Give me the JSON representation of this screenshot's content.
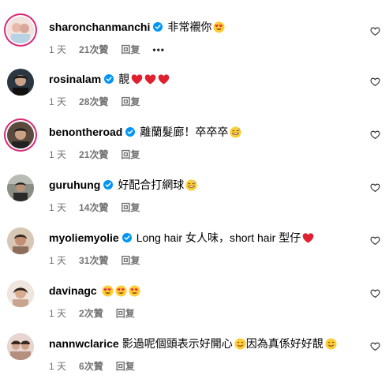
{
  "comments": [
    {
      "username": "sharonchanmanchi",
      "text": "非常襯你",
      "emojis": [
        "heart-eyes"
      ],
      "time": "1 天",
      "likes": "21次贊",
      "reply": "回复",
      "more": "•••",
      "avatar_color": "#e9c7c3",
      "story_ring": true
    },
    {
      "username": "rosinalam",
      "text": "靚",
      "emojis": [
        "red-heart",
        "red-heart",
        "red-heart"
      ],
      "time": "1 天",
      "likes": "28次贊",
      "reply": "回复",
      "avatar_color": "#2b2b2b",
      "story_ring": false
    },
    {
      "username": "benontheroad",
      "text": "離蘭髮廊！卒卒卒",
      "emojis": [
        "grin-sweat"
      ],
      "time": "1 天",
      "likes": "21次贊",
      "reply": "回复",
      "avatar_color": "#3a2d2a",
      "story_ring": true
    },
    {
      "username": "guruhung",
      "text": "好配合打網球",
      "emojis": [
        "grin-sweat"
      ],
      "time": "1 天",
      "likes": "14次贊",
      "reply": "回复",
      "avatar_color": "#4a4a4a",
      "story_ring": false
    },
    {
      "username": "myoliemyolie",
      "text": "Long hair 女人味，short hair 型仔",
      "emojis": [
        "red-heart"
      ],
      "time": "1 天",
      "likes": "31次贊",
      "reply": "回复",
      "avatar_color": "#a07a66",
      "story_ring": false
    },
    {
      "username": "davinagc",
      "text": "",
      "emojis": [
        "heart-eyes",
        "heart-eyes",
        "heart-eyes"
      ],
      "time": "1 天",
      "likes": "2次贊",
      "reply": "回复",
      "avatar_color": "#c9a48e",
      "story_ring": false
    },
    {
      "username": "nannwclarice",
      "text": "影過呢個頭表示好開心",
      "text2": "因為真係好好靚",
      "emojis": [
        "smile"
      ],
      "emojis2": [
        "smile"
      ],
      "time": "1 天",
      "likes": "6次贊",
      "reply": "回复",
      "avatar_color": "#cfb7a8",
      "story_ring": false
    }
  ],
  "colors": {
    "verified": "#0095f6",
    "muted": "#737373",
    "heart": "#ed4956"
  }
}
